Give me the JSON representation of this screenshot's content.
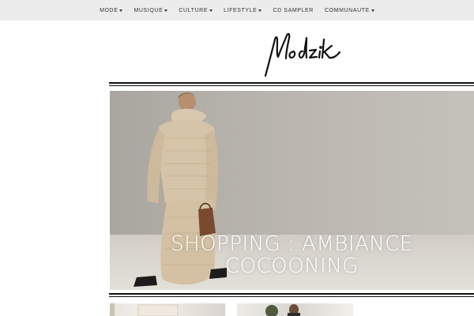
{
  "nav": {
    "items": [
      {
        "label": "MODE",
        "has_dropdown": true
      },
      {
        "label": "MUSIQUE",
        "has_dropdown": true
      },
      {
        "label": "CULTURE",
        "has_dropdown": true
      },
      {
        "label": "LIFESTYLE",
        "has_dropdown": true
      },
      {
        "label": "CD SAMPLER",
        "has_dropdown": false
      },
      {
        "label": "COMMUNAUTE",
        "has_dropdown": true
      }
    ]
  },
  "logo": {
    "text": "Modzik"
  },
  "hero": {
    "title_line1": "SHOPPING : AMBIANCE",
    "title_line2": "COCOONING"
  },
  "colors": {
    "nav_bg": "#ececec",
    "rule": "#111111",
    "hero_text": "#ffffff"
  }
}
